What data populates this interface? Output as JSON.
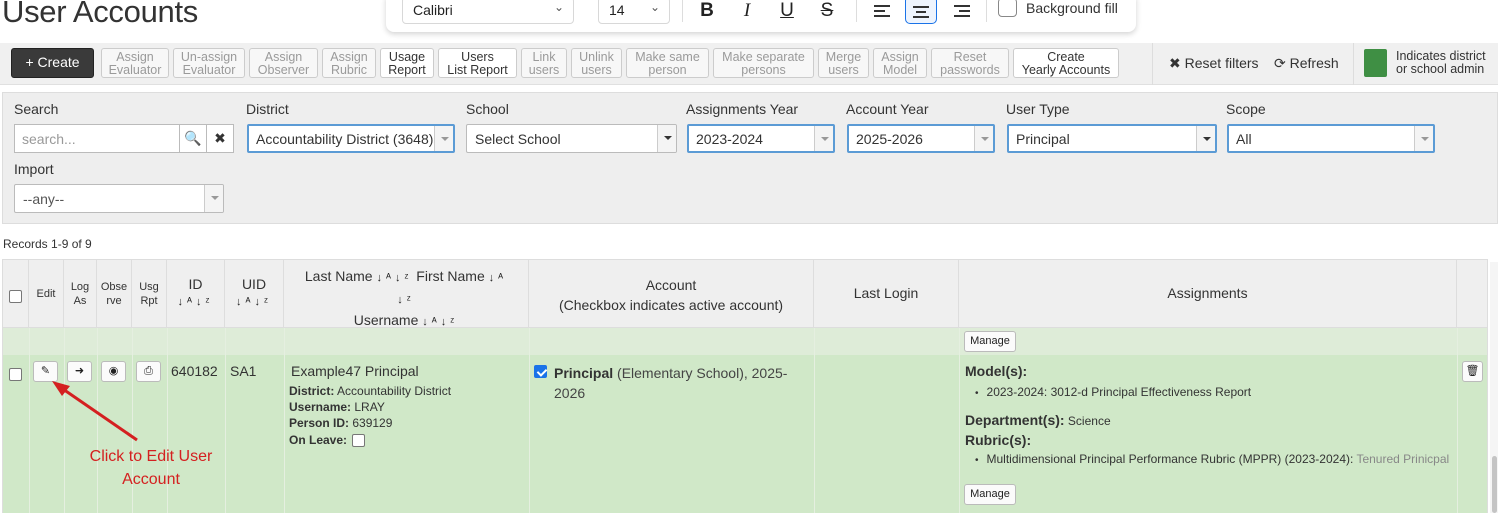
{
  "page": {
    "title": "User Accounts"
  },
  "format_toolbar": {
    "font": "Calibri",
    "size": "14",
    "bold": "B",
    "italic": "I",
    "underline": "U",
    "strike": "S",
    "background_fill": "Background fill"
  },
  "toolbar": {
    "create": "+ Create",
    "buttons": [
      {
        "l1": "Assign",
        "l2": "Evaluator"
      },
      {
        "l1": "Un-assign",
        "l2": "Evaluator"
      },
      {
        "l1": "Assign",
        "l2": "Observer"
      },
      {
        "l1": "Assign",
        "l2": "Rubric"
      },
      {
        "l1": "Usage",
        "l2": "Report"
      },
      {
        "l1": "Users",
        "l2": "List Report"
      },
      {
        "l1": "Link",
        "l2": "users"
      },
      {
        "l1": "Unlink",
        "l2": "users"
      },
      {
        "l1": "Make same",
        "l2": "person"
      },
      {
        "l1": "Make separate",
        "l2": "persons"
      },
      {
        "l1": "Merge",
        "l2": "users"
      },
      {
        "l1": "Assign",
        "l2": "Model"
      },
      {
        "l1": "Reset",
        "l2": "passwords"
      },
      {
        "l1": "Create",
        "l2": "Yearly Accounts"
      }
    ],
    "reset_filters": "Reset filters",
    "refresh": "Refresh",
    "legend_l1": "Indicates district",
    "legend_l2": "or school admin",
    "legend_color": "#3f8f44"
  },
  "filters": {
    "search_label": "Search",
    "search_placeholder": "search...",
    "district_label": "District",
    "district_value": "Accountability District (3648)",
    "school_label": "School",
    "school_value": "Select School",
    "assign_year_label": "Assignments Year",
    "assign_year_value": "2023-2024",
    "account_year_label": "Account Year",
    "account_year_value": "2025-2026",
    "user_type_label": "User Type",
    "user_type_value": "Principal",
    "scope_label": "Scope",
    "scope_value": "All",
    "import_label": "Import",
    "import_value": "--any--"
  },
  "records": "Records 1-9 of 9",
  "table": {
    "headers": {
      "edit": "Edit",
      "log_as_1": "Log",
      "log_as_2": "As",
      "observe_1": "Obse",
      "observe_2": "rve",
      "usg_1": "Usg",
      "usg_2": "Rpt",
      "id": "ID",
      "uid": "UID",
      "last_name": "Last Name",
      "first_name": "First Name",
      "username": "Username",
      "account_1": "Account",
      "account_2": "(Checkbox indicates active account)",
      "last_login": "Last Login",
      "assignments": "Assignments"
    },
    "manage": "Manage",
    "row": {
      "id": "640182",
      "uid": "SA1",
      "name": "Example47  Principal",
      "district_label": "District:",
      "district": "Accountability District",
      "username_label": "Username:",
      "username": "LRAY",
      "person_id_label": "Person ID:",
      "person_id": "639129",
      "on_leave_label": "On Leave:",
      "account_role": "Principal",
      "account_rest_1": "(Elementary School), 2025-",
      "account_rest_2": "2026",
      "models_label": "Model(s):",
      "model_1": "2023-2024: 3012-d Principal Effectiveness Report",
      "departments_label": "Department(s):",
      "department": "Science",
      "rubrics_label": "Rubric(s):",
      "rubric_1": "Multidimensional Principal Performance Rubric (MPPR) (2023-2024):",
      "rubric_note": "Tenured Prinicpal"
    }
  },
  "annotation": {
    "l1": "Click to Edit User",
    "l2": "Account"
  }
}
